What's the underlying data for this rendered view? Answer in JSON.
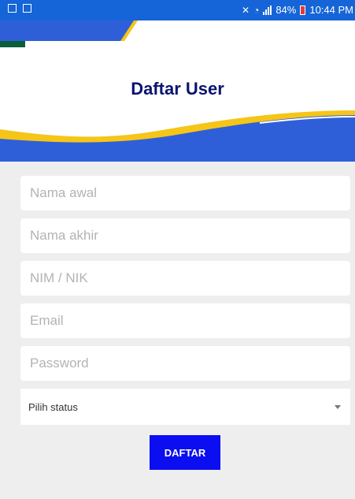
{
  "status_bar": {
    "battery_text": "84%",
    "time": "10:44 PM",
    "icons": [
      "gallery-icon",
      "mail-icon",
      "mute-icon",
      "wifi-icon",
      "signal-icon",
      "battery-icon"
    ]
  },
  "page": {
    "title": "Daftar User"
  },
  "form": {
    "first_name_placeholder": "Nama awal",
    "last_name_placeholder": "Nama akhir",
    "nim_placeholder": "NIM / NIK",
    "email_placeholder": "Email",
    "password_placeholder": "Password",
    "status_selected": "Pilih status",
    "submit_label": "DAFTAR"
  },
  "colors": {
    "status_bar": "#1565d8",
    "header_blue": "#2f5fd8",
    "accent_yellow": "#f5c518",
    "dark_green": "#0b5d3b",
    "title_navy": "#0a1470",
    "button_blue": "#0a0ef0",
    "form_bg": "#eeeeee"
  }
}
